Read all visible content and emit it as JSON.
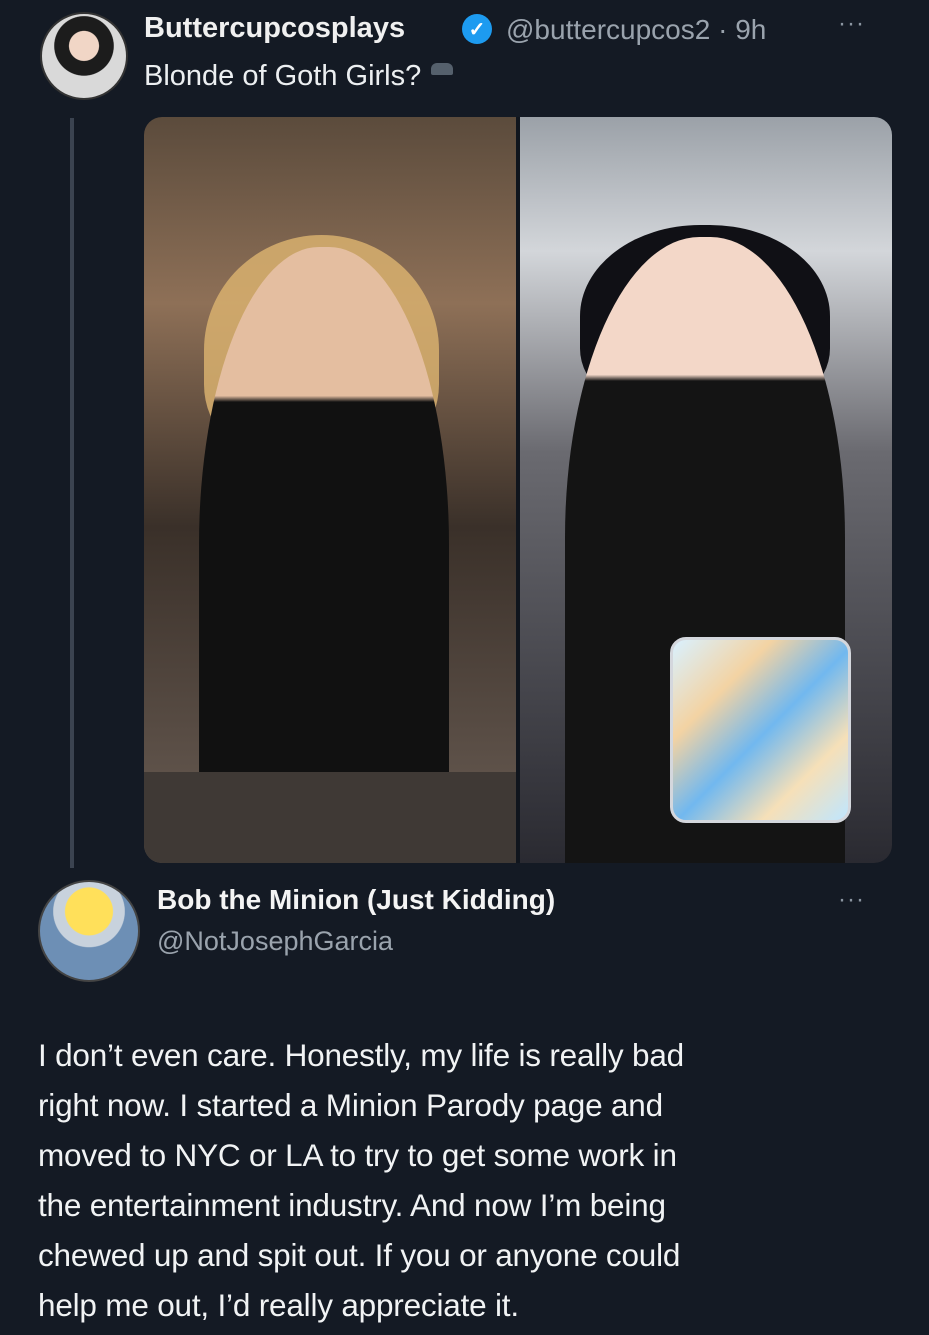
{
  "tweet1": {
    "author_name": "Buttercupcosplays",
    "verified_icon": "verified-badge-icon",
    "handle_time": "@buttercupcos2 · 9h",
    "more_label": "···",
    "text": "Blonde of Goth Girls?",
    "media": [
      {
        "name": "blonde-photo"
      },
      {
        "name": "goth-photo"
      }
    ]
  },
  "tweet2": {
    "author_name": "Bob the Minion (Just Kidding)",
    "handle": "@NotJosephGarcia",
    "more_label": "···",
    "text_lines": [
      "I don’t even care. Honestly, my life is really bad",
      "right now. I started a Minion Parody page and",
      "moved to NYC or LA to try to get some work in",
      "the entertainment industry. And now I’m being",
      "chewed up and spit out. If you or anyone could",
      "help me out, I’d really appreciate it."
    ]
  },
  "colors": {
    "background": "#141a24",
    "verified_blue": "#1d9bf0",
    "secondary_text": "#9aa3ad"
  }
}
